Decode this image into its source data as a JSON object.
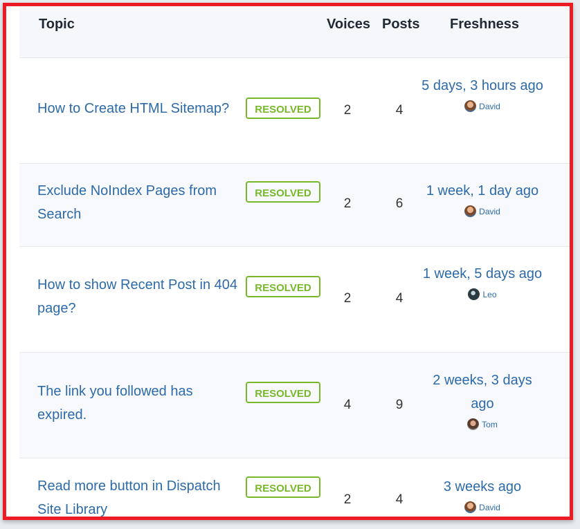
{
  "header": {
    "topic": "Topic",
    "voices": "Voices",
    "posts": "Posts",
    "freshness": "Freshness"
  },
  "topics": [
    {
      "title": "How to Create HTML Sitemap?",
      "badge": "RESOLVED",
      "voices": "2",
      "posts": "4",
      "freshness": "5 days, 3 hours ago",
      "author": "David",
      "avatar_icon": "david-avatar"
    },
    {
      "title": "Exclude NoIndex Pages from Search",
      "badge": "RESOLVED",
      "voices": "2",
      "posts": "6",
      "freshness": "1 week, 1 day ago",
      "author": "David",
      "avatar_icon": "david-avatar"
    },
    {
      "title": "How to show Recent Post in 404 page?",
      "badge": "RESOLVED",
      "voices": "2",
      "posts": "4",
      "freshness": "1 week, 5 days ago",
      "author": "Leo",
      "avatar_icon": "leo-avatar"
    },
    {
      "title": "The link you followed has expired.",
      "badge": "RESOLVED",
      "voices": "4",
      "posts": "9",
      "freshness": "2 weeks, 3 days ago",
      "author": "Tom",
      "avatar_icon": "tom-avatar"
    },
    {
      "title": "Read more button in Dispatch Site Library",
      "badge": "RESOLVED",
      "voices": "2",
      "posts": "4",
      "freshness": "3 weeks ago",
      "author": "David",
      "avatar_icon": "david-avatar"
    }
  ],
  "colors": {
    "frame": "#ed1c24",
    "link": "#2d6aa9",
    "resolved": "#77b82a"
  }
}
